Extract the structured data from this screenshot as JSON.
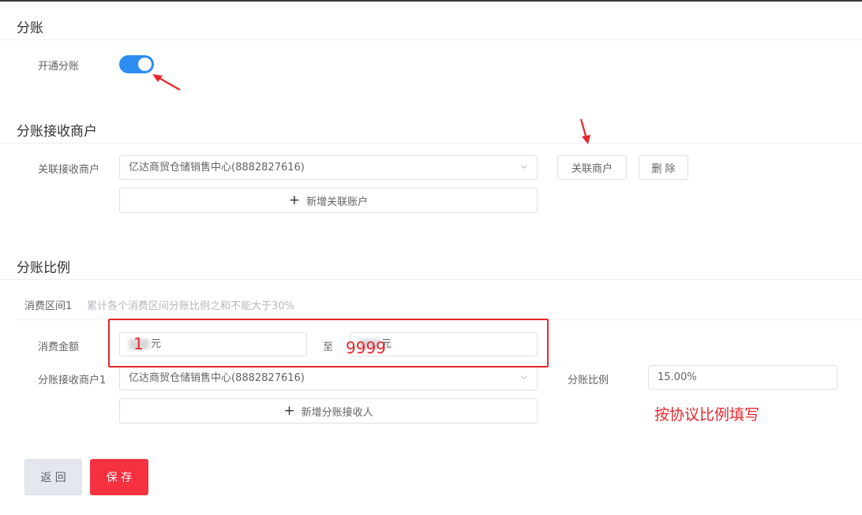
{
  "sections": {
    "split": {
      "title": "分账",
      "enable_label": "开通分账",
      "enabled": true
    },
    "receivers": {
      "title": "分账接收商户",
      "field_label": "关联接收商户",
      "selected": "亿达商贸仓储销售中心(8882827616)",
      "link_button": "关联商户",
      "delete_button": "删 除",
      "add_button": "新增关联账户"
    },
    "ratio": {
      "title": "分账比例",
      "range_label": "消费区间1",
      "range_hint": "累计各个消费区间分账比例之和不能大于30%",
      "amount_label": "消费金额",
      "amount_from_suffix": "元",
      "to_label": "至",
      "amount_to_suffix": "元",
      "receiver_label": "分账接收商户1",
      "receiver_selected": "亿达商贸仓储销售中心(8882827616)",
      "ratio_label": "分账比例",
      "ratio_value": "15.00%",
      "add_receiver_button": "新增分账接收人"
    }
  },
  "annotations": {
    "from_value": "1",
    "to_value": "9999",
    "ratio_note": "按协议比例填写",
    "color": "#e8262d"
  },
  "footer": {
    "back_button": "返 回",
    "save_button": "保 存"
  },
  "colors": {
    "switch_on": "#2d8cf0",
    "save": "#f5303f",
    "back": "#e4e7ed"
  }
}
